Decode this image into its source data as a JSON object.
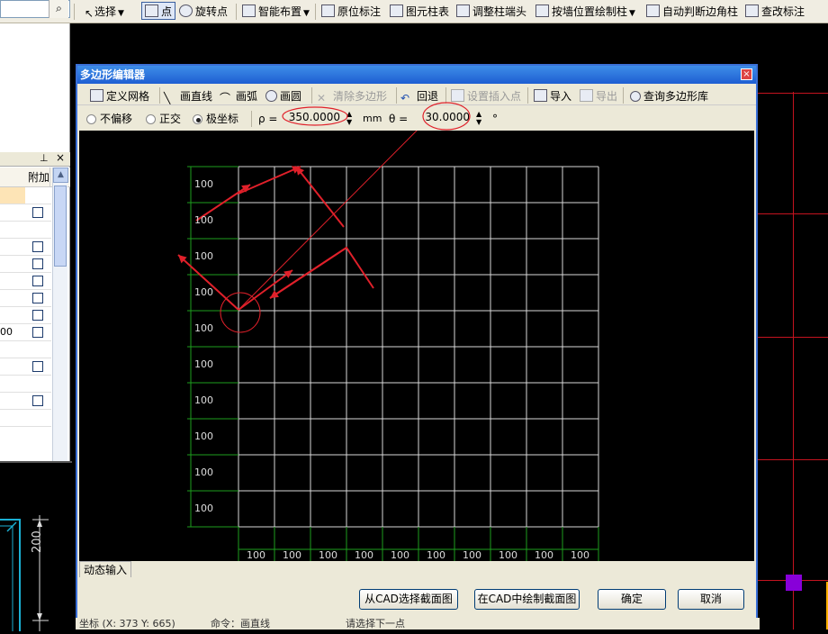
{
  "toolbar": {
    "select": "选择",
    "point": "点",
    "rotate_point": "旋转点",
    "smart_layout": "智能布置",
    "origin_mark": "原位标注",
    "column_table": "图元柱表",
    "adjust_col_end": "调整柱端头",
    "draw_by_wall": "按墙位置绘制柱",
    "auto_corner": "自动判断边角柱",
    "check_mark": "查改标注"
  },
  "dialog": {
    "title": "多边形编辑器",
    "close": "×",
    "tools": {
      "define_grid": "定义网格",
      "draw_line": "画直线",
      "draw_arc": "画弧",
      "draw_circle": "画圆",
      "clear_polygon": "清除多边形",
      "undo": "回退",
      "set_insert_point": "设置插入点",
      "import": "导入",
      "export": "导出",
      "query_library": "查询多边形库"
    },
    "modes": {
      "no_offset": "不偏移",
      "orthogonal": "正交",
      "polar": "极坐标",
      "selected": "polar"
    },
    "rho_label": "ρ =",
    "rho_value": "350.0000",
    "rho_unit": "mm",
    "theta_label": "θ =",
    "theta_value": "30.0000",
    "theta_unit": "°",
    "grid": {
      "row_labels": [
        "100",
        "100",
        "100",
        "100",
        "100",
        "100",
        "100",
        "100",
        "100",
        "100"
      ],
      "col_labels": [
        "100",
        "100",
        "100",
        "100",
        "100",
        "100",
        "100",
        "100",
        "100",
        "100"
      ]
    },
    "dynamic_input_tab": "动态输入",
    "buttons": {
      "from_cad": "从CAD选择截面图",
      "draw_in_cad": "在CAD中绘制截面图",
      "ok": "确定",
      "cancel": "取消"
    }
  },
  "left_panel": {
    "attach_header": "附加",
    "partial_value": "00"
  },
  "cad": {
    "dim_value": "200"
  },
  "status": {
    "coords": "坐标 (X: 373 Y: 665)",
    "command": "命令：画直线",
    "prompt": "请选择下一点"
  },
  "colors": {
    "accent": "#3a6fd6",
    "grid_line": "#d8d8d8",
    "dim_green": "#1e9e1e",
    "annotation_red": "#e0202a",
    "marker_purple": "#8800d9"
  }
}
